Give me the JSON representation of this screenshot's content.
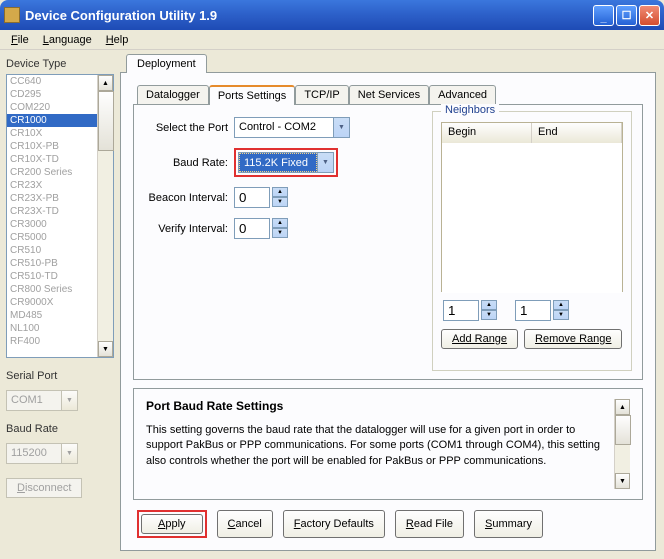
{
  "title": "Device Configuration Utility 1.9",
  "menu": {
    "file": "File",
    "language": "Language",
    "help": "Help"
  },
  "left": {
    "device_type_label": "Device Type",
    "devices": [
      "CC640",
      "CD295",
      "COM220",
      "CR1000",
      "CR10X",
      "CR10X-PB",
      "CR10X-TD",
      "CR200 Series",
      "CR23X",
      "CR23X-PB",
      "CR23X-TD",
      "CR3000",
      "CR5000",
      "CR510",
      "CR510-PB",
      "CR510-TD",
      "CR800 Series",
      "CR9000X",
      "MD485",
      "NL100",
      "RF400"
    ],
    "selected_device_index": 3,
    "serial_port_label": "Serial Port",
    "serial_port_value": "COM1",
    "baud_rate_label": "Baud Rate",
    "baud_rate_value": "115200",
    "disconnect": "Disconnect"
  },
  "main_tab": "Deployment",
  "sub_tabs": [
    "Datalogger",
    "Ports Settings",
    "TCP/IP",
    "Net Services",
    "Advanced"
  ],
  "active_sub_tab": 1,
  "form": {
    "select_port_label": "Select the Port",
    "select_port_value": "Control - COM2",
    "baud_rate_label": "Baud Rate:",
    "baud_rate_value": "115.2K Fixed",
    "beacon_label": "Beacon Interval:",
    "beacon_value": "0",
    "verify_label": "Verify Interval:",
    "verify_value": "0"
  },
  "neighbors": {
    "legend": "Neighbors",
    "begin": "Begin",
    "end": "End",
    "spin1": "1",
    "spin2": "1",
    "add_range": "Add Range",
    "remove_range": "Remove Range"
  },
  "info": {
    "title": "Port Baud Rate Settings",
    "text": "This setting governs the baud rate that the datalogger will use for a given port in order to support PakBus or PPP communications. For some ports (COM1 through COM4), this setting also controls whether the port will be enabled for PakBus or PPP communications."
  },
  "buttons": {
    "apply": "Apply",
    "cancel": "Cancel",
    "factory": "Factory Defaults",
    "read_file": "Read File",
    "summary": "Summary"
  }
}
